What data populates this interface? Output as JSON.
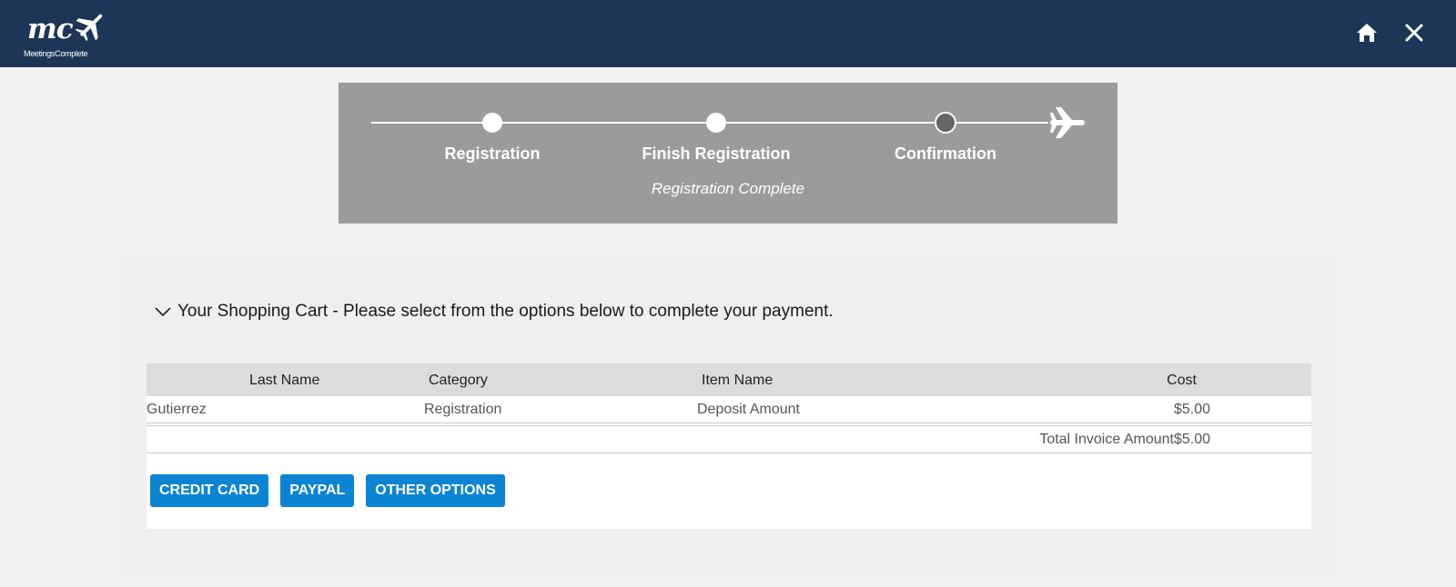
{
  "header": {
    "logo_text": "mc",
    "logo_subtitle": "MeetingsComplete",
    "home_icon": "home-icon",
    "close_icon": "close-icon",
    "background": "#1d3557"
  },
  "progress": {
    "steps": [
      {
        "label": "Registration",
        "state": "complete"
      },
      {
        "label": "Finish Registration",
        "state": "complete"
      },
      {
        "label": "Confirmation",
        "state": "current"
      }
    ],
    "status_text": "Registration Complete",
    "end_icon": "airplane-icon"
  },
  "cart": {
    "title": "Your Shopping Cart - Please select from the options below to complete your payment.",
    "columns": [
      "Last Name",
      "Category",
      "Item Name",
      "Cost"
    ],
    "rows": [
      {
        "last_name": "Gutierrez",
        "category": "Registration",
        "item_name": "Deposit Amount",
        "cost": "$5.00"
      }
    ],
    "total_label": "Total Invoice Amount",
    "total_value": "$5.00"
  },
  "payment_buttons": {
    "credit_card": "CREDIT CARD",
    "paypal": "PAYPAL",
    "other": "OTHER OPTIONS"
  },
  "colors": {
    "accent": "#0b84d4",
    "progress_bg": "#9b9b9b",
    "step_current": "#666666"
  }
}
